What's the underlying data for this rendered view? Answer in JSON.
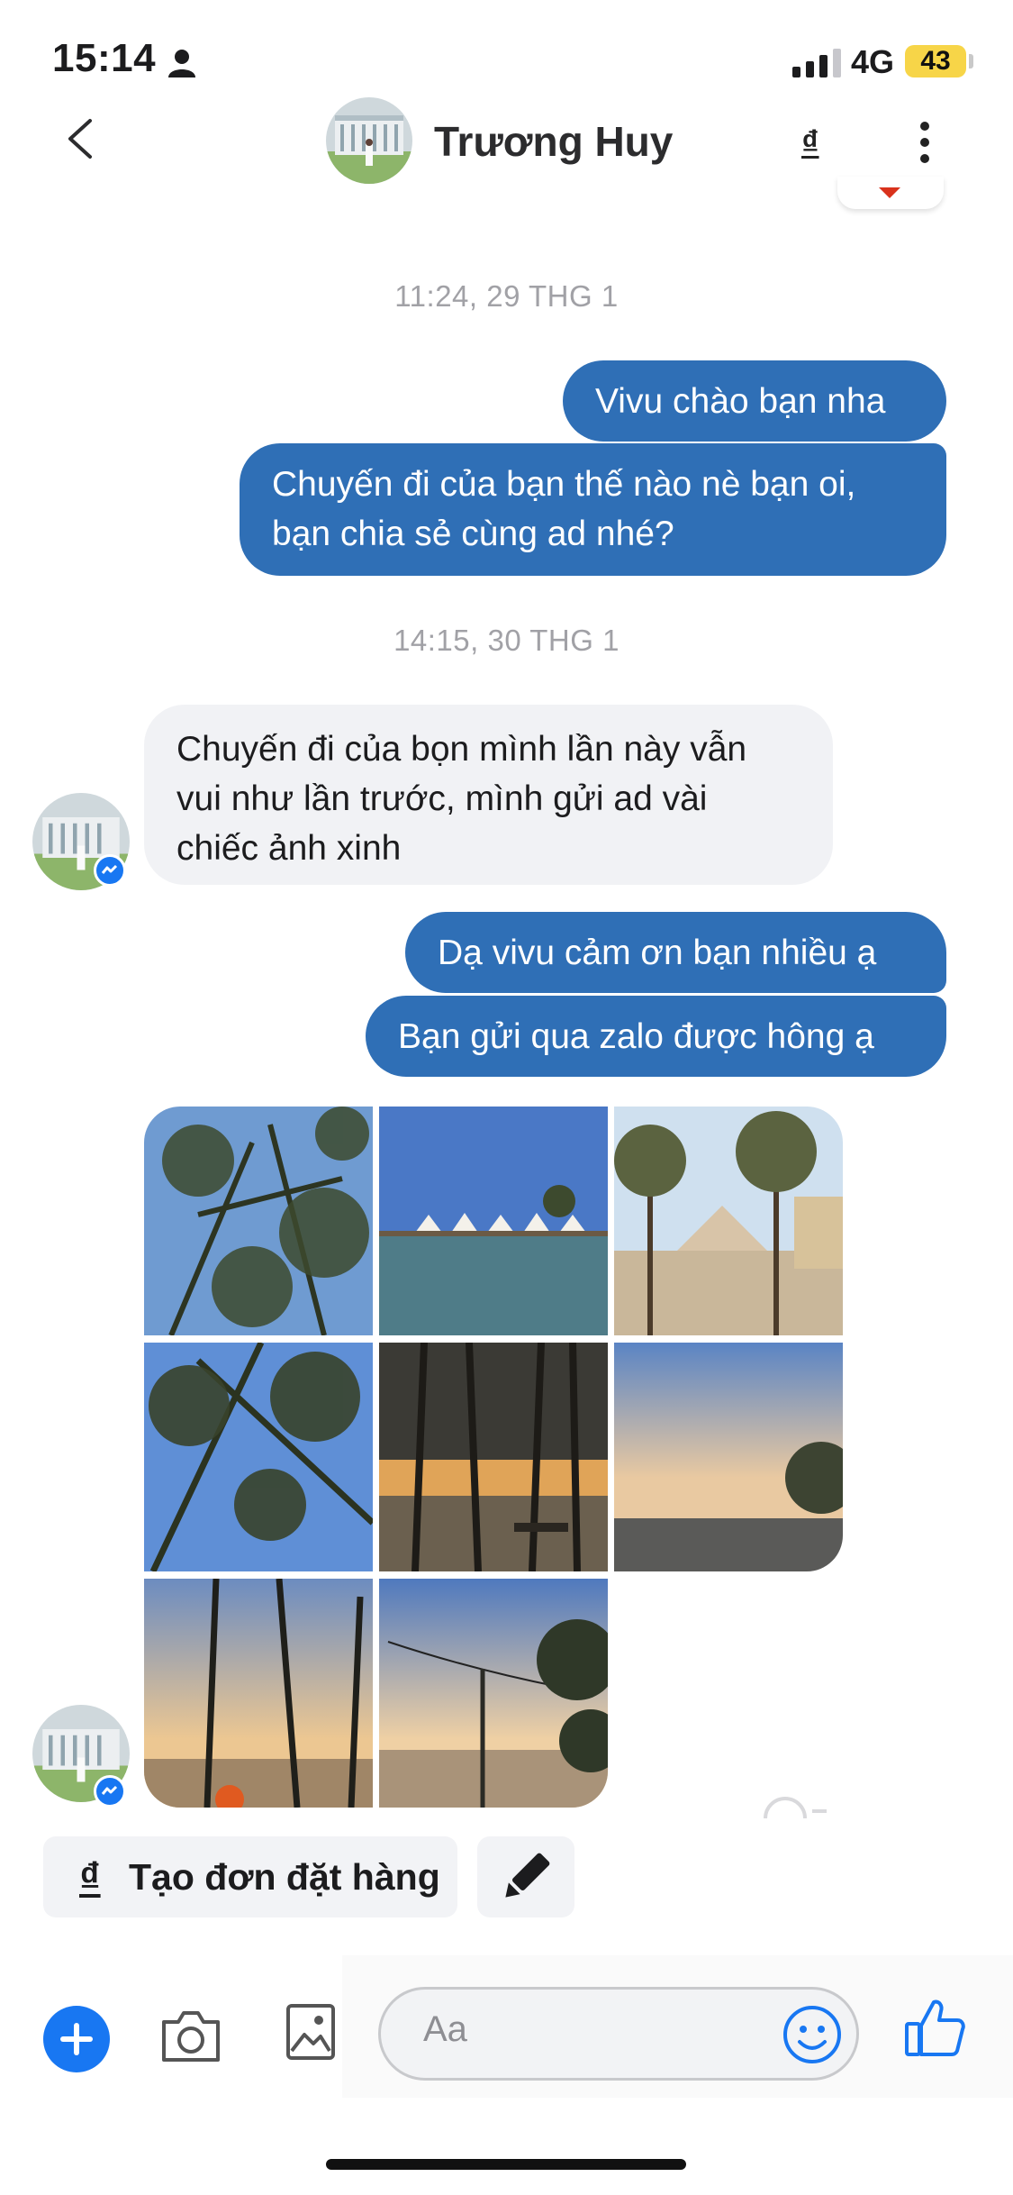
{
  "status_bar": {
    "time": "15:14",
    "network": "4G",
    "battery": "43"
  },
  "header": {
    "name": "Trương Huy",
    "order_icon_label": "₫"
  },
  "messages": [
    {
      "type": "timestamp",
      "text": "11:24, 29 THG 1"
    },
    {
      "type": "outgoing",
      "lines": [
        "Vivu chào bạn nha"
      ]
    },
    {
      "type": "outgoing",
      "lines": [
        "Chuyến đi của bạn thế nào nè bạn oi,",
        "bạn chia sẻ cùng ad nhé?"
      ]
    },
    {
      "type": "timestamp",
      "text": "14:15, 30 THG 1"
    },
    {
      "type": "incoming",
      "lines": [
        "Chuyến đi của bọn mình lần này vẫn",
        "vui như lần trước, mình gửi ad vài",
        "chiếc ảnh xinh"
      ]
    },
    {
      "type": "outgoing",
      "lines": [
        "Dạ vivu cảm ơn bạn nhiều ạ"
      ]
    },
    {
      "type": "outgoing",
      "lines": [
        "Bạn gửi qua zalo được hông ạ"
      ]
    },
    {
      "type": "photos",
      "count": 8
    }
  ],
  "actions": {
    "create_order_icon": "₫",
    "create_order_label": "Tạo đơn đặt hàng"
  },
  "composer": {
    "placeholder": "Aa"
  },
  "colors": {
    "accent": "#1877f2",
    "outgoing_bubble": "#2f6fb6",
    "incoming_bubble": "#f1f2f5"
  }
}
